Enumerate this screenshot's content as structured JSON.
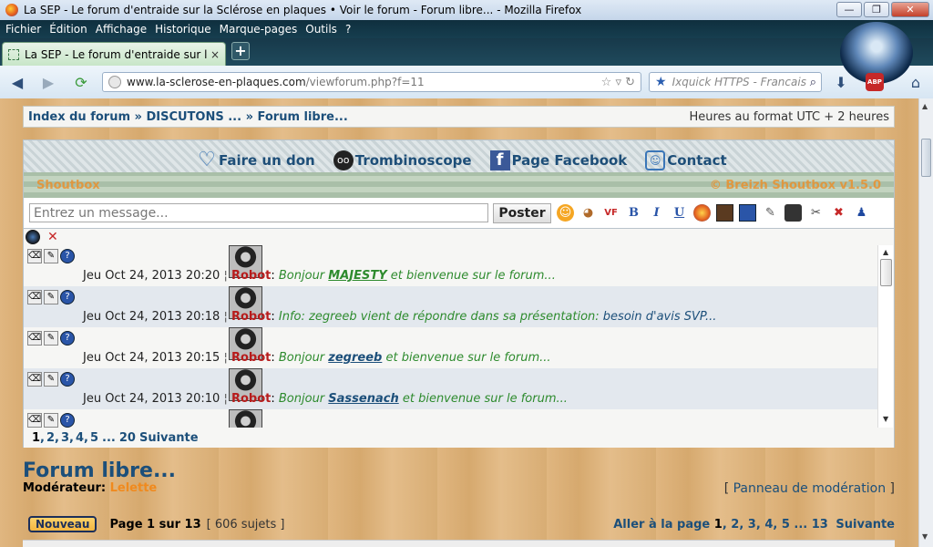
{
  "window": {
    "title": "La SEP - Le forum d'entraide sur la Sclérose en plaques • Voir le forum - Forum libre... - Mozilla Firefox",
    "minimize": "—",
    "maximize": "❐",
    "close": "✕"
  },
  "menu": [
    "Fichier",
    "Édition",
    "Affichage",
    "Historique",
    "Marque-pages",
    "Outils",
    "?"
  ],
  "tab": {
    "label": "La SEP - Le forum d'entraide sur la ...",
    "close": "×",
    "new": "+"
  },
  "nav": {
    "url_host": "www.la-sclerose-en-plaques.com",
    "url_path": "/viewforum.php?f=11",
    "search_placeholder": "Ixquick HTTPS - Francais",
    "abp": "ABP"
  },
  "breadcrumb": {
    "path": "Index du forum » DISCUTONS ... » Forum libre...",
    "timezone": "Heures au format UTC + 2 heures"
  },
  "top_links": [
    {
      "label": "Faire un don",
      "icon": "heart-icon"
    },
    {
      "label": "Trombinoscope",
      "icon": "face-icon"
    },
    {
      "label": "Page Facebook",
      "icon": "facebook-icon"
    },
    {
      "label": "Contact",
      "icon": "contact-icon"
    }
  ],
  "shoutbox": {
    "title": "Shoutbox",
    "version": "© Breizh Shoutbox v1.5.0",
    "input_placeholder": "Entrez un message...",
    "post_label": "Poster",
    "messages": [
      {
        "date": "Jeu Oct 24, 2013 20:20",
        "author": "Robot",
        "pre": "Bonjour ",
        "user": "MAJESTY",
        "post": " et bienvenue sur le forum...",
        "user_style": "green"
      },
      {
        "date": "Jeu Oct 24, 2013 20:18",
        "author": "Robot",
        "pre": "Info: zegreeb vient de répondre dans sa présentation: ",
        "link": "besoin d'avis SVP...",
        "user_style": "link"
      },
      {
        "date": "Jeu Oct 24, 2013 20:15",
        "author": "Robot",
        "pre": "Bonjour ",
        "user": "zegreeb",
        "post": " et bienvenue sur le forum...",
        "user_style": "blue"
      },
      {
        "date": "Jeu Oct 24, 2013 20:10",
        "author": "Robot",
        "pre": "Bonjour ",
        "user": "Sassenach",
        "post": " et bienvenue sur le forum...",
        "user_style": "blue"
      }
    ],
    "pager": {
      "current": "1",
      "pages": [
        "2",
        "3",
        "4",
        "5"
      ],
      "ellipsis": "...",
      "last": "20",
      "next": "Suivante"
    }
  },
  "forum": {
    "title": "Forum libre...",
    "moderator_label": "Modérateur:",
    "moderator_name": "Lelette",
    "mod_panel": "Panneau de modération",
    "new_button": "Nouveau",
    "page_info": "Page 1 sur 13",
    "topic_count": "[ 606 sujets ]",
    "goto_label": "Aller à la page",
    "goto_current": "1",
    "goto_pages": [
      "2",
      "3",
      "4",
      "5"
    ],
    "goto_ellipsis": "...",
    "goto_last": "13",
    "goto_next": "Suivante"
  },
  "colors": {
    "accent": "#1c4f7a",
    "robot": "#b71c1c",
    "shout_green": "#2e8b2e",
    "orange": "#f08a1e"
  }
}
